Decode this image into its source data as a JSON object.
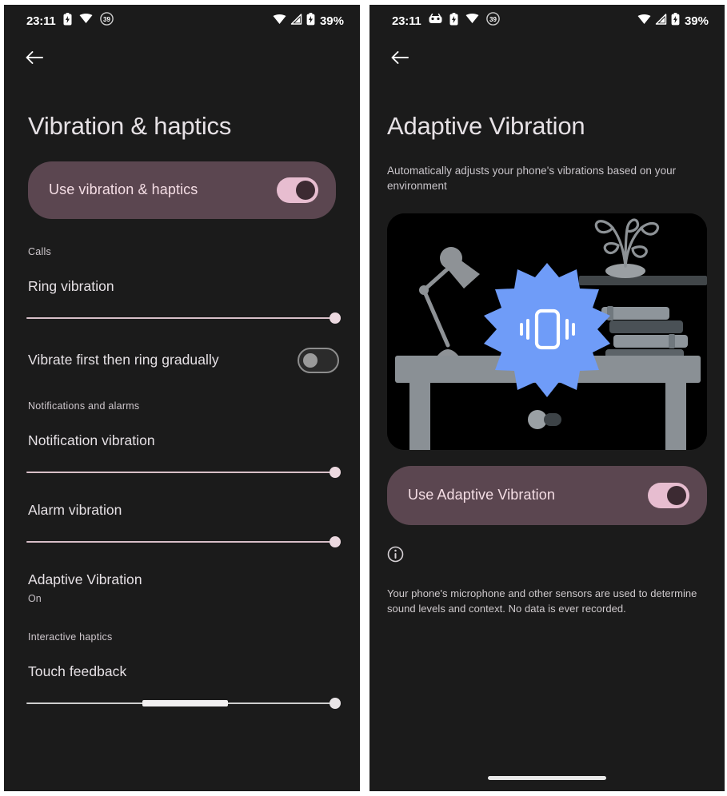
{
  "status_bar": {
    "time": "23:11",
    "battery_percent": "39%",
    "left_icons_left_panel": [
      "battery-saver-icon",
      "wifi-calling-icon",
      "do-not-disturb-39-icon"
    ],
    "left_icons_right_panel": [
      "screenshot-icon",
      "battery-saver-icon",
      "wifi-calling-icon",
      "do-not-disturb-39-icon"
    ],
    "right_icons": [
      "wifi-icon",
      "cellular-signal-icon",
      "battery-icon"
    ]
  },
  "left_screen": {
    "back_label": "Back",
    "title": "Vibration & haptics",
    "master_toggle": {
      "label": "Use vibration & haptics",
      "state": "on"
    },
    "sections": [
      {
        "header": "Calls",
        "items": [
          {
            "type": "slider",
            "title": "Ring vibration",
            "value": 100
          },
          {
            "type": "switch",
            "title": "Vibrate first then ring gradually",
            "state": "off"
          }
        ]
      },
      {
        "header": "Notifications and alarms",
        "items": [
          {
            "type": "slider",
            "title": "Notification vibration",
            "value": 100
          },
          {
            "type": "slider",
            "title": "Alarm vibration",
            "value": 100
          },
          {
            "type": "link",
            "title": "Adaptive Vibration",
            "subtitle": "On"
          }
        ]
      },
      {
        "header": "Interactive haptics",
        "items": [
          {
            "type": "slider",
            "title": "Touch feedback",
            "value": 100
          }
        ]
      }
    ]
  },
  "right_screen": {
    "back_label": "Back",
    "title": "Adaptive Vibration",
    "subtitle": "Automatically adjusts your phone's vibrations based on your environment",
    "illustration": {
      "name": "desk-with-vibrating-phone-illustration",
      "background": "#000000",
      "accent": "#6f9cf8",
      "elements": [
        "desk",
        "desk-lamp",
        "wall-shelf",
        "potted-plant",
        "book-stack",
        "vibration-burst-badge",
        "toggle-graphic"
      ]
    },
    "master_toggle": {
      "label": "Use Adaptive Vibration",
      "state": "on"
    },
    "info_icon": "info-circle-icon",
    "info_text": "Your phone's microphone and other sensors are used to determine sound levels and context. No data is ever recorded."
  },
  "colors": {
    "screen_background": "#1b1b1b",
    "pill_background": "#5b4650",
    "pill_text": "#f4dde4",
    "switch_on_track": "#e7bdd0",
    "switch_on_knob": "#3c2a32",
    "switch_off_border": "#8d8d8d",
    "slider_track": "#d8bfc8",
    "slider_thumb": "#ecd9e0",
    "title_text": "#e6e1e5",
    "secondary_text": "#c9c5ca",
    "illustration_accent": "#6f9cf8"
  }
}
